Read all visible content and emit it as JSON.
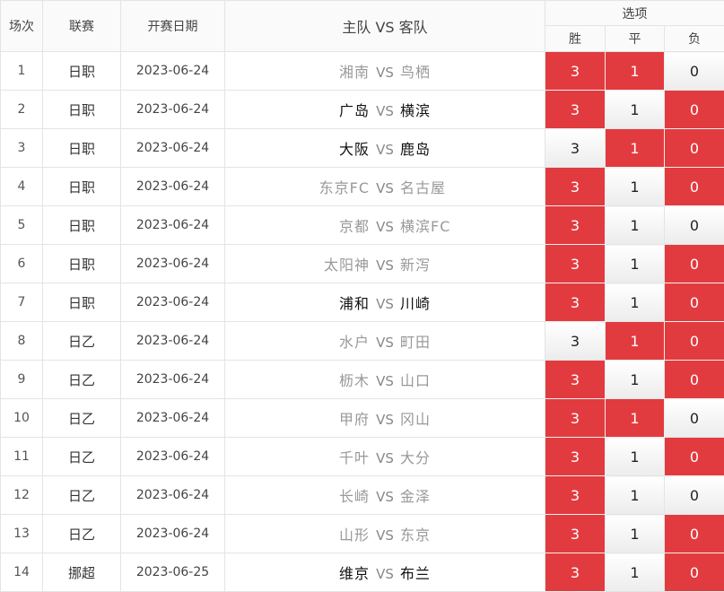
{
  "header": {
    "col_round": "场次",
    "col_league": "联赛",
    "col_date": "开赛日期",
    "col_match": "主队 VS 客队",
    "col_options": "选项",
    "opt_win": "胜",
    "opt_draw": "平",
    "opt_loss": "负"
  },
  "colors": {
    "selected": "#e23b3f",
    "unselected": "#f0f0f0"
  },
  "rows": [
    {
      "num": "1",
      "league": "日职",
      "date": "2023-06-24",
      "home": "湘南",
      "vs": "VS",
      "away": "鸟栖",
      "style": "dim",
      "win": "3",
      "draw": "1",
      "loss": "0",
      "win_sel": true,
      "draw_sel": true,
      "loss_sel": false
    },
    {
      "num": "2",
      "league": "日职",
      "date": "2023-06-24",
      "home": "广岛",
      "vs": "VS",
      "away": "横滨",
      "style": "dark",
      "win": "3",
      "draw": "1",
      "loss": "0",
      "win_sel": true,
      "draw_sel": false,
      "loss_sel": true
    },
    {
      "num": "3",
      "league": "日职",
      "date": "2023-06-24",
      "home": "大阪",
      "vs": "VS",
      "away": "鹿岛",
      "style": "dark",
      "win": "3",
      "draw": "1",
      "loss": "0",
      "win_sel": false,
      "draw_sel": true,
      "loss_sel": true
    },
    {
      "num": "4",
      "league": "日职",
      "date": "2023-06-24",
      "home": "东京FC",
      "vs": "VS",
      "away": "名古屋",
      "style": "dim",
      "win": "3",
      "draw": "1",
      "loss": "0",
      "win_sel": true,
      "draw_sel": false,
      "loss_sel": true
    },
    {
      "num": "5",
      "league": "日职",
      "date": "2023-06-24",
      "home": "京都",
      "vs": "VS",
      "away": "横滨FC",
      "style": "dim",
      "win": "3",
      "draw": "1",
      "loss": "0",
      "win_sel": true,
      "draw_sel": false,
      "loss_sel": false
    },
    {
      "num": "6",
      "league": "日职",
      "date": "2023-06-24",
      "home": "太阳神",
      "vs": "VS",
      "away": "新泻",
      "style": "dim",
      "win": "3",
      "draw": "1",
      "loss": "0",
      "win_sel": true,
      "draw_sel": false,
      "loss_sel": true
    },
    {
      "num": "7",
      "league": "日职",
      "date": "2023-06-24",
      "home": "浦和",
      "vs": "VS",
      "away": "川崎",
      "style": "dark",
      "win": "3",
      "draw": "1",
      "loss": "0",
      "win_sel": true,
      "draw_sel": false,
      "loss_sel": true
    },
    {
      "num": "8",
      "league": "日乙",
      "date": "2023-06-24",
      "home": "水户",
      "vs": "VS",
      "away": "町田",
      "style": "dim",
      "win": "3",
      "draw": "1",
      "loss": "0",
      "win_sel": false,
      "draw_sel": true,
      "loss_sel": true
    },
    {
      "num": "9",
      "league": "日乙",
      "date": "2023-06-24",
      "home": "枥木",
      "vs": "VS",
      "away": "山口",
      "style": "dim",
      "win": "3",
      "draw": "1",
      "loss": "0",
      "win_sel": true,
      "draw_sel": false,
      "loss_sel": true
    },
    {
      "num": "10",
      "league": "日乙",
      "date": "2023-06-24",
      "home": "甲府",
      "vs": "VS",
      "away": "冈山",
      "style": "dim",
      "win": "3",
      "draw": "1",
      "loss": "0",
      "win_sel": true,
      "draw_sel": true,
      "loss_sel": false
    },
    {
      "num": "11",
      "league": "日乙",
      "date": "2023-06-24",
      "home": "千叶",
      "vs": "VS",
      "away": "大分",
      "style": "dim",
      "win": "3",
      "draw": "1",
      "loss": "0",
      "win_sel": true,
      "draw_sel": false,
      "loss_sel": true
    },
    {
      "num": "12",
      "league": "日乙",
      "date": "2023-06-24",
      "home": "长崎",
      "vs": "VS",
      "away": "金泽",
      "style": "dim",
      "win": "3",
      "draw": "1",
      "loss": "0",
      "win_sel": true,
      "draw_sel": false,
      "loss_sel": false
    },
    {
      "num": "13",
      "league": "日乙",
      "date": "2023-06-24",
      "home": "山形",
      "vs": "VS",
      "away": "东京",
      "style": "dim",
      "win": "3",
      "draw": "1",
      "loss": "0",
      "win_sel": true,
      "draw_sel": false,
      "loss_sel": true
    },
    {
      "num": "14",
      "league": "挪超",
      "date": "2023-06-25",
      "home": "维京",
      "vs": "VS",
      "away": "布兰",
      "style": "dark",
      "win": "3",
      "draw": "1",
      "loss": "0",
      "win_sel": true,
      "draw_sel": false,
      "loss_sel": true
    }
  ]
}
